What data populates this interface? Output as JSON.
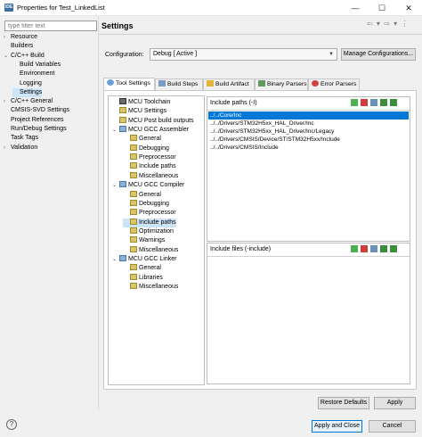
{
  "window": {
    "title": "Properties for Test_LinkedList",
    "controls": {
      "minimize": "—",
      "maximize": "☐",
      "close": "✕"
    }
  },
  "filter": {
    "placeholder": "type filter text"
  },
  "left_tree": {
    "items": [
      {
        "label": "Resource",
        "twisty": "›",
        "indent": 0
      },
      {
        "label": "Builders",
        "twisty": "",
        "indent": 0
      },
      {
        "label": "C/C++ Build",
        "twisty": "⌄",
        "indent": 0
      },
      {
        "label": "Build Variables",
        "twisty": "",
        "indent": 1
      },
      {
        "label": "Environment",
        "twisty": "",
        "indent": 1
      },
      {
        "label": "Logging",
        "twisty": "",
        "indent": 1
      },
      {
        "label": "Settings",
        "twisty": "",
        "indent": 1,
        "selected": true
      },
      {
        "label": "C/C++ General",
        "twisty": "›",
        "indent": 0
      },
      {
        "label": "CMSIS-SVD Settings",
        "twisty": "",
        "indent": 0
      },
      {
        "label": "Project References",
        "twisty": "",
        "indent": 0
      },
      {
        "label": "Run/Debug Settings",
        "twisty": "",
        "indent": 0
      },
      {
        "label": "Task Tags",
        "twisty": "",
        "indent": 0
      },
      {
        "label": "Validation",
        "twisty": "›",
        "indent": 0
      }
    ]
  },
  "header": {
    "title": "Settings",
    "nav": "⇦ ▾ ⇨ ▾ ⋮"
  },
  "configuration": {
    "label": "Configuration:",
    "value": "Debug  [ Active ]",
    "manage_button": "Manage Configurations..."
  },
  "tabs": [
    {
      "label": "Tool Settings",
      "active": true
    },
    {
      "label": "Build Steps",
      "active": false
    },
    {
      "label": "Build Artifact",
      "active": false
    },
    {
      "label": "Binary Parsers",
      "active": false
    },
    {
      "label": "Error Parsers",
      "active": false
    }
  ],
  "tool_tree": {
    "items": [
      {
        "label": "MCU Toolchain",
        "level": 0,
        "icon": "tool",
        "twisty": ""
      },
      {
        "label": "MCU Settings",
        "level": 0,
        "icon": "leaf",
        "twisty": ""
      },
      {
        "label": "MCU Post build outputs",
        "level": 0,
        "icon": "leaf",
        "twisty": ""
      },
      {
        "label": "MCU GCC Assembler",
        "level": 0,
        "icon": "grp",
        "twisty": "⌄"
      },
      {
        "label": "General",
        "level": 1,
        "icon": "leaf",
        "twisty": ""
      },
      {
        "label": "Debugging",
        "level": 1,
        "icon": "leaf",
        "twisty": ""
      },
      {
        "label": "Preprocessor",
        "level": 1,
        "icon": "leaf",
        "twisty": ""
      },
      {
        "label": "Include paths",
        "level": 1,
        "icon": "leaf",
        "twisty": ""
      },
      {
        "label": "Miscellaneous",
        "level": 1,
        "icon": "leaf",
        "twisty": ""
      },
      {
        "label": "MCU GCC Compiler",
        "level": 0,
        "icon": "grp",
        "twisty": "⌄"
      },
      {
        "label": "General",
        "level": 1,
        "icon": "leaf",
        "twisty": ""
      },
      {
        "label": "Debugging",
        "level": 1,
        "icon": "leaf",
        "twisty": ""
      },
      {
        "label": "Preprocessor",
        "level": 1,
        "icon": "leaf",
        "twisty": ""
      },
      {
        "label": "Include paths",
        "level": 1,
        "icon": "leaf",
        "twisty": "",
        "selected": true
      },
      {
        "label": "Optimization",
        "level": 1,
        "icon": "leaf",
        "twisty": ""
      },
      {
        "label": "Warnings",
        "level": 1,
        "icon": "leaf",
        "twisty": ""
      },
      {
        "label": "Miscellaneous",
        "level": 1,
        "icon": "leaf",
        "twisty": ""
      },
      {
        "label": "MCU GCC Linker",
        "level": 0,
        "icon": "grp",
        "twisty": "⌄"
      },
      {
        "label": "General",
        "level": 1,
        "icon": "leaf",
        "twisty": ""
      },
      {
        "label": "Libraries",
        "level": 1,
        "icon": "leaf",
        "twisty": ""
      },
      {
        "label": "Miscellaneous",
        "level": 1,
        "icon": "leaf",
        "twisty": ""
      }
    ]
  },
  "include_paths": {
    "label": "Include paths (-I)",
    "items": [
      {
        "path": "../../Core/Inc",
        "selected": true
      },
      {
        "path": "../../Drivers/STM32H5xx_HAL_Driver/Inc",
        "selected": false
      },
      {
        "path": "../../Drivers/STM32H5xx_HAL_Driver/Inc/Legacy",
        "selected": false
      },
      {
        "path": "../../Drivers/CMSIS/Device/ST/STM32H5xx/Include",
        "selected": false
      },
      {
        "path": "../../Drivers/CMSIS/Include",
        "selected": false
      }
    ]
  },
  "include_files": {
    "label": "Include files (-include)",
    "items": []
  },
  "buttons": {
    "restore_defaults": "Restore Defaults",
    "apply": "Apply",
    "apply_and_close": "Apply and Close",
    "cancel": "Cancel",
    "help": "?"
  },
  "colors": {
    "selection": "#0078d7",
    "tree_selection": "#cce4f7",
    "accent_border": "#0078d7"
  }
}
